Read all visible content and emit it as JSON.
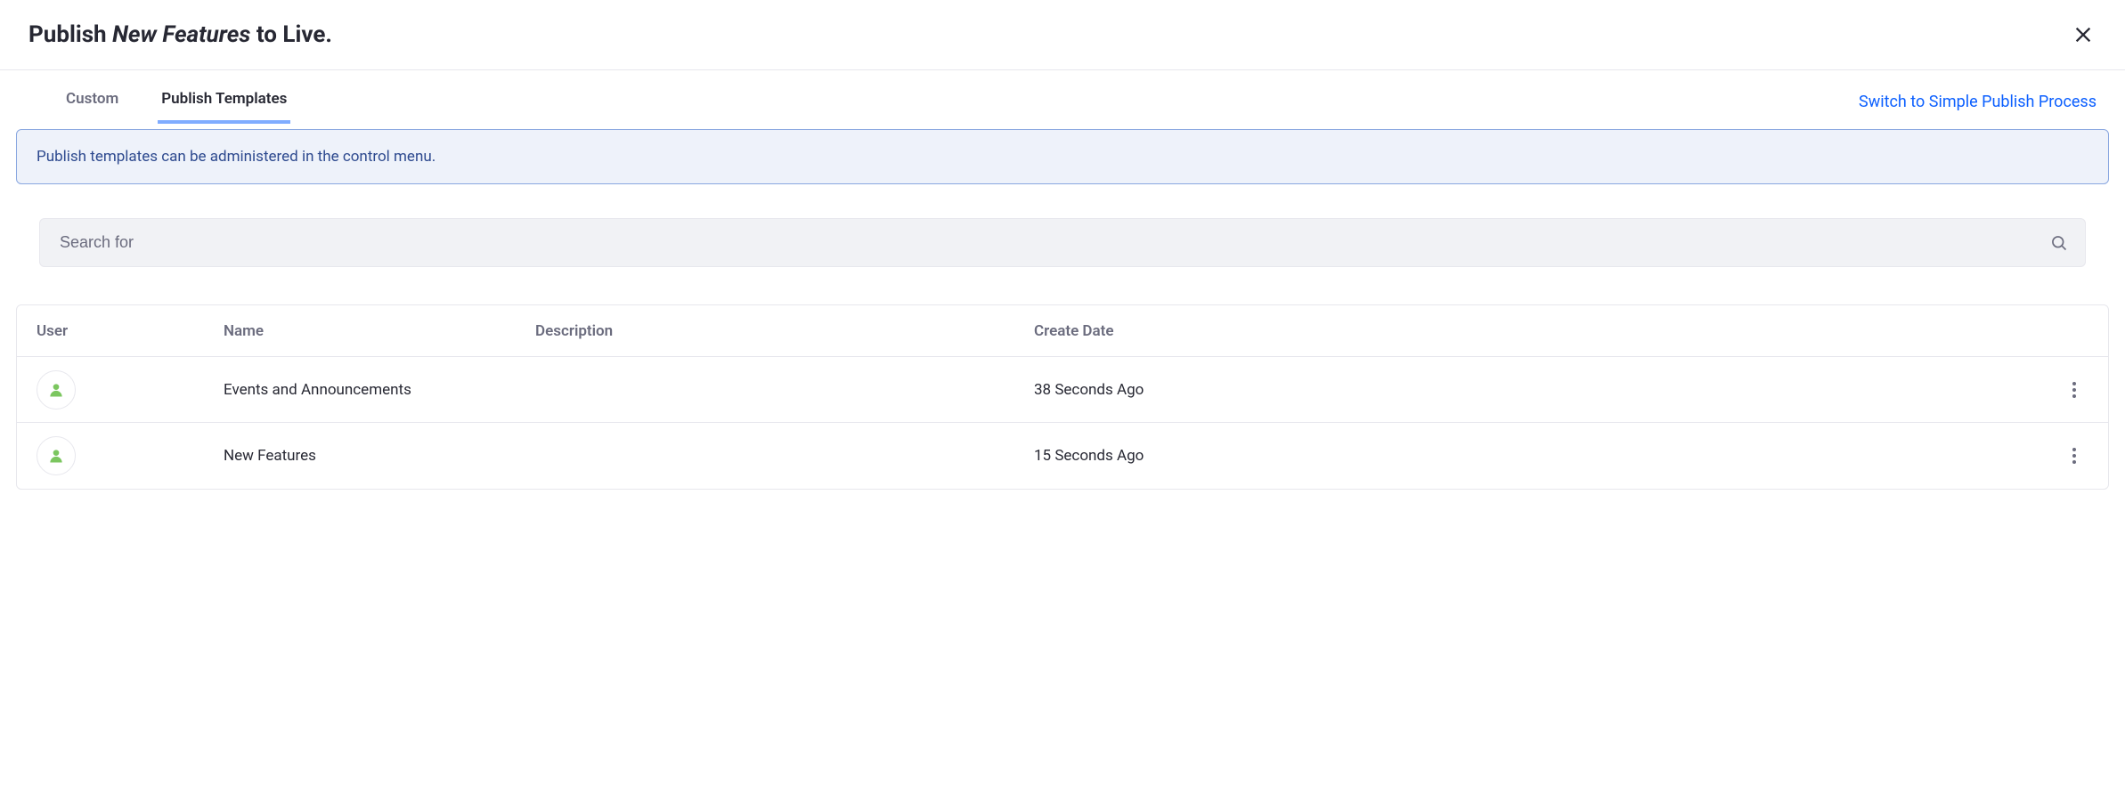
{
  "header": {
    "title_prefix": "Publish ",
    "title_italic": "New Features",
    "title_suffix": " to Live."
  },
  "tabs": {
    "custom": "Custom",
    "publish_templates": "Publish Templates"
  },
  "switch_link": "Switch to Simple Publish Process",
  "alert_text": "Publish templates can be administered in the control menu.",
  "search": {
    "placeholder": "Search for"
  },
  "table": {
    "headers": {
      "user": "User",
      "name": "Name",
      "description": "Description",
      "create_date": "Create Date"
    },
    "rows": [
      {
        "name": "Events and Announcements",
        "description": "",
        "create_date": "38 Seconds Ago"
      },
      {
        "name": "New Features",
        "description": "",
        "create_date": "15 Seconds Ago"
      }
    ]
  }
}
